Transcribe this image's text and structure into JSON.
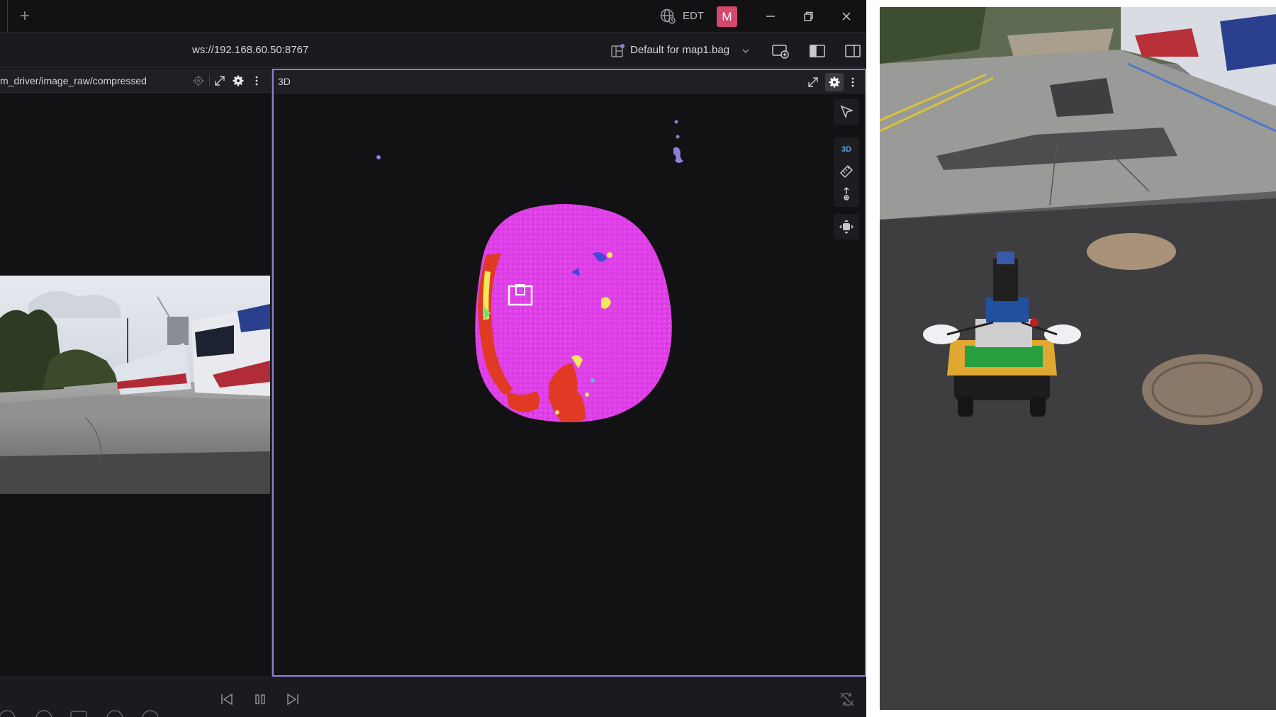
{
  "titlebar": {
    "new_tab_label": "+",
    "timezone": "EDT",
    "avatar_initial": "M",
    "avatar_color": "#d6476e"
  },
  "toolbar": {
    "connection_url": "ws://192.168.60.50:8767",
    "layout_name": "Default for map1.bag"
  },
  "panels": {
    "image_panel_title": "m_driver/image_raw/compressed",
    "threed_panel_title": "3D",
    "threed_mode_label": "3D"
  },
  "colors": {
    "accent_border": "#8e7fd6",
    "ground_points": "#e040e8",
    "obstacle_points": "#e03a24",
    "avatar": "#d6476e"
  },
  "icons": [
    "plus-icon",
    "globe-icon",
    "minimize-icon",
    "restore-icon",
    "close-icon",
    "layout-icon",
    "chevron-down-icon",
    "add-panel-icon",
    "left-sidebar-icon",
    "right-sidebar-icon",
    "crosshair-icon",
    "expand-icon",
    "gear-icon",
    "more-icon",
    "select-cursor-icon",
    "ruler-icon",
    "publish-point-icon",
    "camera-move-icon",
    "skip-back-icon",
    "pause-icon",
    "skip-forward-icon",
    "loop-icon"
  ]
}
